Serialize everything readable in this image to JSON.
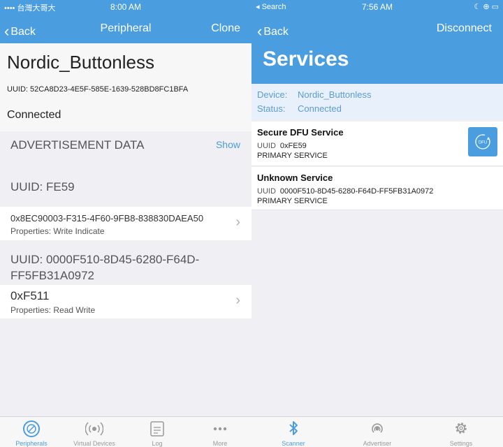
{
  "left": {
    "status": {
      "carrier": "•••• 台灣大哥大",
      "time": "8:00 AM",
      "battery": "⊕ ◑ ▭"
    },
    "nav": {
      "back": "Back",
      "title": "Peripheral",
      "action": "Clone"
    },
    "device_name": "Nordic_Buttonless",
    "uuid_line": "UUID: 52CA8D23-4E5F-585E-1639-528BD8FC1BFA",
    "state": "Connected",
    "advertisement": {
      "label": "ADVERTISEMENT DATA",
      "action": "Show"
    },
    "services": [
      {
        "header": "UUID: FE59",
        "characteristics": [
          {
            "name": "0x8EC90003-F315-4F60-9FB8-838830DAEA50",
            "properties": "Properties: Write Indicate"
          }
        ]
      },
      {
        "header": "UUID: 0000F510-8D45-6280-F64D-FF5FB31A0972",
        "characteristics": [
          {
            "name": "0xF511",
            "properties": "Properties: Read Write"
          }
        ]
      }
    ],
    "tabs": [
      {
        "label": "Peripherals",
        "icon": "peripherals-icon",
        "active": true
      },
      {
        "label": "Virtual Devices",
        "icon": "broadcast-icon",
        "active": false
      },
      {
        "label": "Log",
        "icon": "log-icon",
        "active": false
      },
      {
        "label": "More",
        "icon": "more-icon",
        "active": false
      }
    ]
  },
  "right": {
    "status": {
      "carrier": "◂ Search",
      "time": "7:56 AM",
      "battery": "☾ ⊕ ▭"
    },
    "nav": {
      "back": "Back",
      "action": "Disconnect",
      "title": "Services"
    },
    "info": {
      "device_key": "Device:",
      "device_value": "Nordic_Buttonless",
      "status_key": "Status:",
      "status_value": "Connected"
    },
    "services": [
      {
        "name": "Secure DFU Service",
        "uuid_label": "UUID",
        "uuid": "0xFE59",
        "type": "PRIMARY SERVICE",
        "dfu_label": "DFU"
      },
      {
        "name": "Unknown Service",
        "uuid_label": "UUID",
        "uuid": "0000F510-8D45-6280-F64D-FF5FB31A0972",
        "type": "PRIMARY SERVICE"
      }
    ],
    "tabs": [
      {
        "label": "Scanner",
        "icon": "bluetooth-icon",
        "active": true
      },
      {
        "label": "Advertiser",
        "icon": "advertiser-icon",
        "active": false
      },
      {
        "label": "Settings",
        "icon": "gear-icon",
        "active": false
      }
    ]
  },
  "colors": {
    "accent": "#4a9ee0",
    "info_text": "#5b9bd5",
    "background": "#efeff4"
  }
}
